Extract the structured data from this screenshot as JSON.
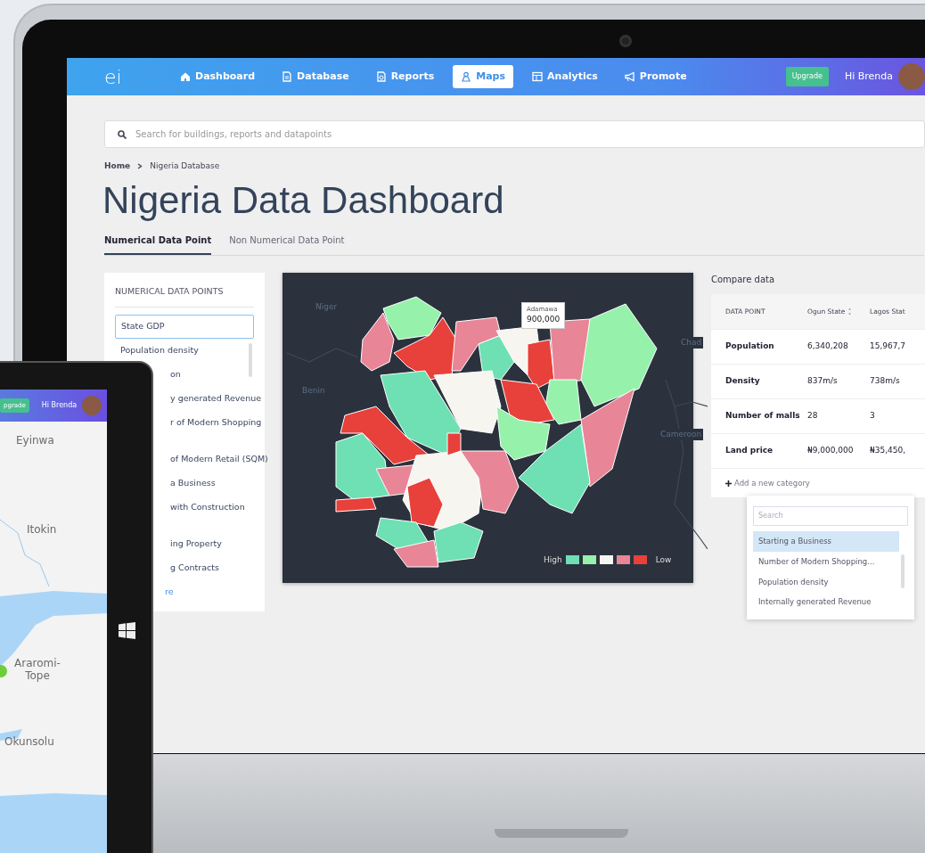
{
  "laptop": {
    "navbar": {
      "logo": "ei",
      "items": [
        {
          "label": "Dashboard",
          "selected": false
        },
        {
          "label": "Database",
          "selected": false
        },
        {
          "label": "Reports",
          "selected": false
        },
        {
          "label": "Maps",
          "selected": true
        },
        {
          "label": "Analytics",
          "selected": false
        },
        {
          "label": "Promote",
          "selected": false
        }
      ],
      "upgrade": "Upgrade",
      "greeting": "Hi Brenda"
    },
    "search": {
      "placeholder": "Search for buildings, reports and datapoints"
    },
    "breadcrumb": [
      "Home",
      "Nigeria Database"
    ],
    "title": "Nigeria Data Dashboard",
    "tabs": [
      {
        "label": "Numerical Data Point",
        "selected": true
      },
      {
        "label": "Non Numerical Data Point",
        "selected": false
      }
    ],
    "data_points": {
      "heading": "NUMERICAL DATA POINTS",
      "items": [
        {
          "label": "State GDP",
          "kind": "full",
          "selected": true
        },
        {
          "label": "Population density",
          "kind": "full",
          "selected": false
        },
        {
          "label": "on",
          "kind": "partial",
          "selected": false
        },
        {
          "label": "y generated Revenue",
          "kind": "partial",
          "selected": false
        },
        {
          "label": "r of Modern Shopping",
          "kind": "partial",
          "selected": false
        },
        {
          "label": "of Modern Retail (SQM)",
          "kind": "partial",
          "selected": false
        },
        {
          "label": "a Business",
          "kind": "partial",
          "selected": false
        },
        {
          "label": "with Construction",
          "kind": "partial",
          "selected": false
        },
        {
          "label": "ing Property",
          "kind": "partial",
          "selected": false
        },
        {
          "label": "g Contracts",
          "kind": "partial",
          "selected": false
        },
        {
          "label": "re",
          "kind": "link",
          "selected": false
        }
      ]
    },
    "map": {
      "labels": [
        "Niger",
        "Benin",
        "Chad",
        "Cameroon"
      ],
      "tooltip": {
        "name": "Adamawa",
        "value": "900,000"
      },
      "legend": {
        "high": "High",
        "low": "Low",
        "swatches": [
          {
            "color": "#6ee0b4"
          },
          {
            "color": "#96f2ab"
          },
          {
            "color": "#f7f5f0"
          },
          {
            "color": "#e88597"
          },
          {
            "color": "#e8403a"
          }
        ]
      }
    },
    "compare": {
      "title": "Compare data",
      "columns": [
        "DATA POINT",
        "Ogun State",
        "Lagos Stat"
      ],
      "rows": [
        [
          "Population",
          "6,340,208",
          "15,967,7"
        ],
        [
          "Density",
          "837m/s",
          "738m/s"
        ],
        [
          "Number of malls",
          "28",
          "3"
        ],
        [
          "Land price",
          "₦9,000,000",
          "₦35,450,"
        ]
      ],
      "add": "Add a new category",
      "dropdown": {
        "placeholder": "Search",
        "items": [
          {
            "label": "Starting a Business",
            "selected": true
          },
          {
            "label": "Number of Modern Shopping...",
            "selected": false
          },
          {
            "label": "Population density",
            "selected": false
          },
          {
            "label": "Internally generated Revenue",
            "selected": false
          }
        ]
      }
    }
  },
  "tablet": {
    "upgrade": "pgrade",
    "greeting": "Hi Brenda",
    "places": [
      "Eyinwa",
      "Itokin",
      "Araromi-Tope",
      "Okunsolu"
    ]
  }
}
